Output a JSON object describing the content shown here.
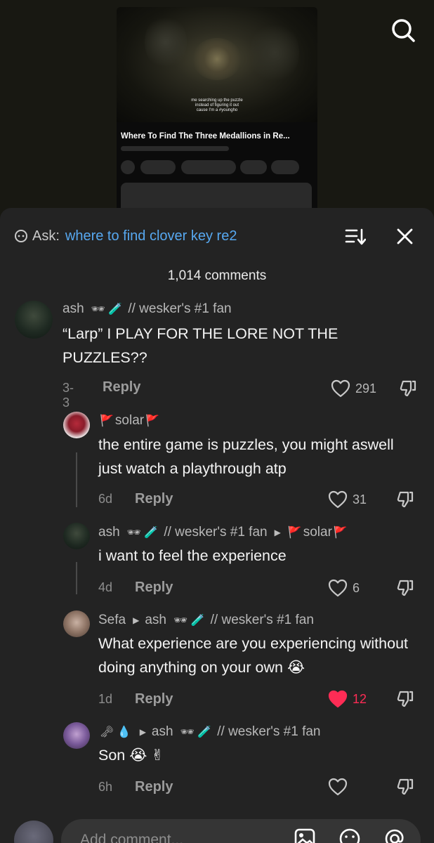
{
  "video": {
    "caption": [
      "me searching up the puzzle",
      "instead of figuring it out",
      "cause I'm a #youngho"
    ],
    "title": "Where To Find The Three Medallions in Re..."
  },
  "top_icons": {
    "search": "search-icon"
  },
  "ask": {
    "label": "Ask:",
    "query": "where to find clover key re2"
  },
  "comments_count": "1,014 comments",
  "comments": [
    {
      "author": "ash",
      "author_suffix": "// wesker's #1 fan",
      "author_emoji": "🕶 🧪",
      "text": "“Larp” I PLAY FOR THE LORE NOT THE PUZZLES??",
      "date": "3-3",
      "reply_label": "Reply",
      "likes": "291",
      "liked": false
    },
    {
      "author": "solar",
      "author_emoji_left": "🚩",
      "author_emoji_right": "🚩",
      "text": "the entire game is puzzles, you might aswell just watch a playthrough atp",
      "date": "6d",
      "reply_label": "Reply",
      "likes": "31",
      "liked": false
    },
    {
      "author": "ash",
      "author_suffix": "// wesker's #1 fan",
      "author_emoji": "🕶 🧪",
      "reply_to": "solar",
      "reply_to_emoji_left": "🚩",
      "reply_to_emoji_right": "🚩",
      "text": "i want to feel the experience",
      "date": "4d",
      "reply_label": "Reply",
      "likes": "6",
      "liked": false
    },
    {
      "author": "Sefa",
      "reply_to": "ash",
      "reply_to_emoji": "🕶 🧪",
      "reply_to_suffix": "// wesker's #1 fan",
      "text": "What experience are you experiencing without doing anything on your own 😭",
      "date": "1d",
      "reply_label": "Reply",
      "likes": "12",
      "liked": true
    },
    {
      "author_emoji": "🗝 💧",
      "reply_to": "ash",
      "reply_to_emoji": "🕶 🧪",
      "reply_to_suffix": "// wesker's #1 fan",
      "text": "Son 😭 ✌",
      "date": "6h",
      "reply_label": "Reply",
      "likes": "",
      "liked": false
    }
  ],
  "input": {
    "placeholder": "Add comment..."
  },
  "colors": {
    "accent_blue": "#57a8f0",
    "like_red": "#fe2c55",
    "sheet_bg": "#232323"
  }
}
